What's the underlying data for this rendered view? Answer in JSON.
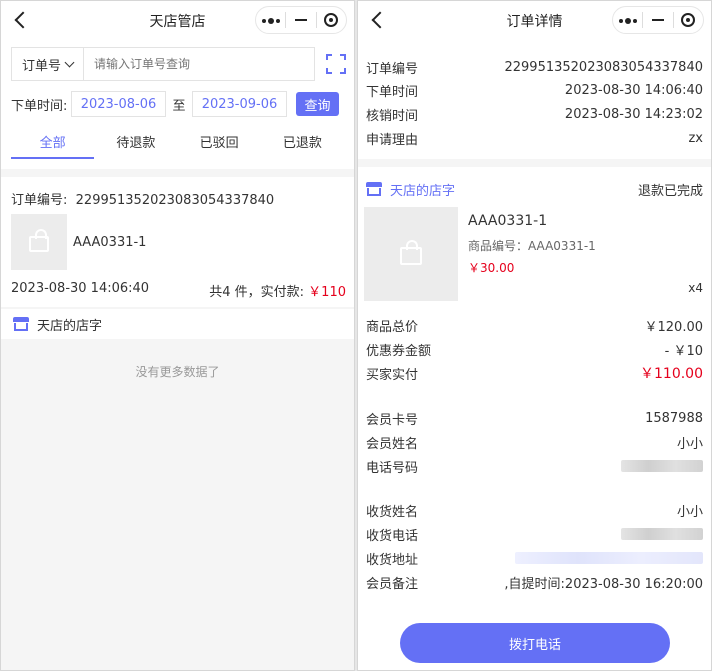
{
  "left": {
    "title": "天店管店",
    "search": {
      "type_label": "订单号",
      "placeholder": "请输入订单号查询"
    },
    "date": {
      "label": "下单时间:",
      "start": "2023-08-06",
      "to": "至",
      "end": "2023-09-06",
      "query_label": "查询"
    },
    "tabs": [
      {
        "label": "全部",
        "active": true
      },
      {
        "label": "待退款",
        "active": false
      },
      {
        "label": "已驳回",
        "active": false
      },
      {
        "label": "已退款",
        "active": false
      }
    ],
    "order": {
      "no_label": "订单编号:",
      "no": "2299513520230830543378​40",
      "product_name": "AAA0331-1",
      "time": "2023-08-30 14:06:40",
      "total_prefix": "共4 件，实付款:",
      "total_amount": "￥110"
    },
    "shop_name": "天店的店字",
    "no_more": "没有更多数据了"
  },
  "right": {
    "title": "订单详情",
    "info": [
      {
        "k": "订单编号",
        "v": "229951352023083054337840"
      },
      {
        "k": "下单时间",
        "v": "2023-08-30 14:06:40"
      },
      {
        "k": "核销时间",
        "v": "2023-08-30 14:23:02"
      },
      {
        "k": "申请理由",
        "v": "zx"
      }
    ],
    "shop_name": "天店的店字",
    "status": "退款已完成",
    "product": {
      "name": "AAA0331-1",
      "code": "商品编号：AAA0331-1",
      "price": "￥30.00",
      "qty": "x4"
    },
    "amounts": [
      {
        "k": "商品总价",
        "v": "￥120.00"
      },
      {
        "k": "优惠券金额",
        "v": "- ￥10"
      },
      {
        "k": "买家实付",
        "v": "￥110.00"
      }
    ],
    "member": [
      {
        "k": "会员卡号",
        "v": "1587988"
      },
      {
        "k": "会员姓名",
        "v": "小小"
      },
      {
        "k": "电话号码",
        "v": ""
      }
    ],
    "receiver": [
      {
        "k": "收货姓名",
        "v": "小小"
      },
      {
        "k": "收货电话",
        "v": ""
      },
      {
        "k": "收货地址",
        "v": ""
      },
      {
        "k": "会员备注",
        "v": ",自提时间:2023-08-30 16:20:00"
      }
    ],
    "call_label": "拨打电话"
  },
  "colors": {
    "accent": "#6470f5",
    "price_red": "#e5001c"
  }
}
